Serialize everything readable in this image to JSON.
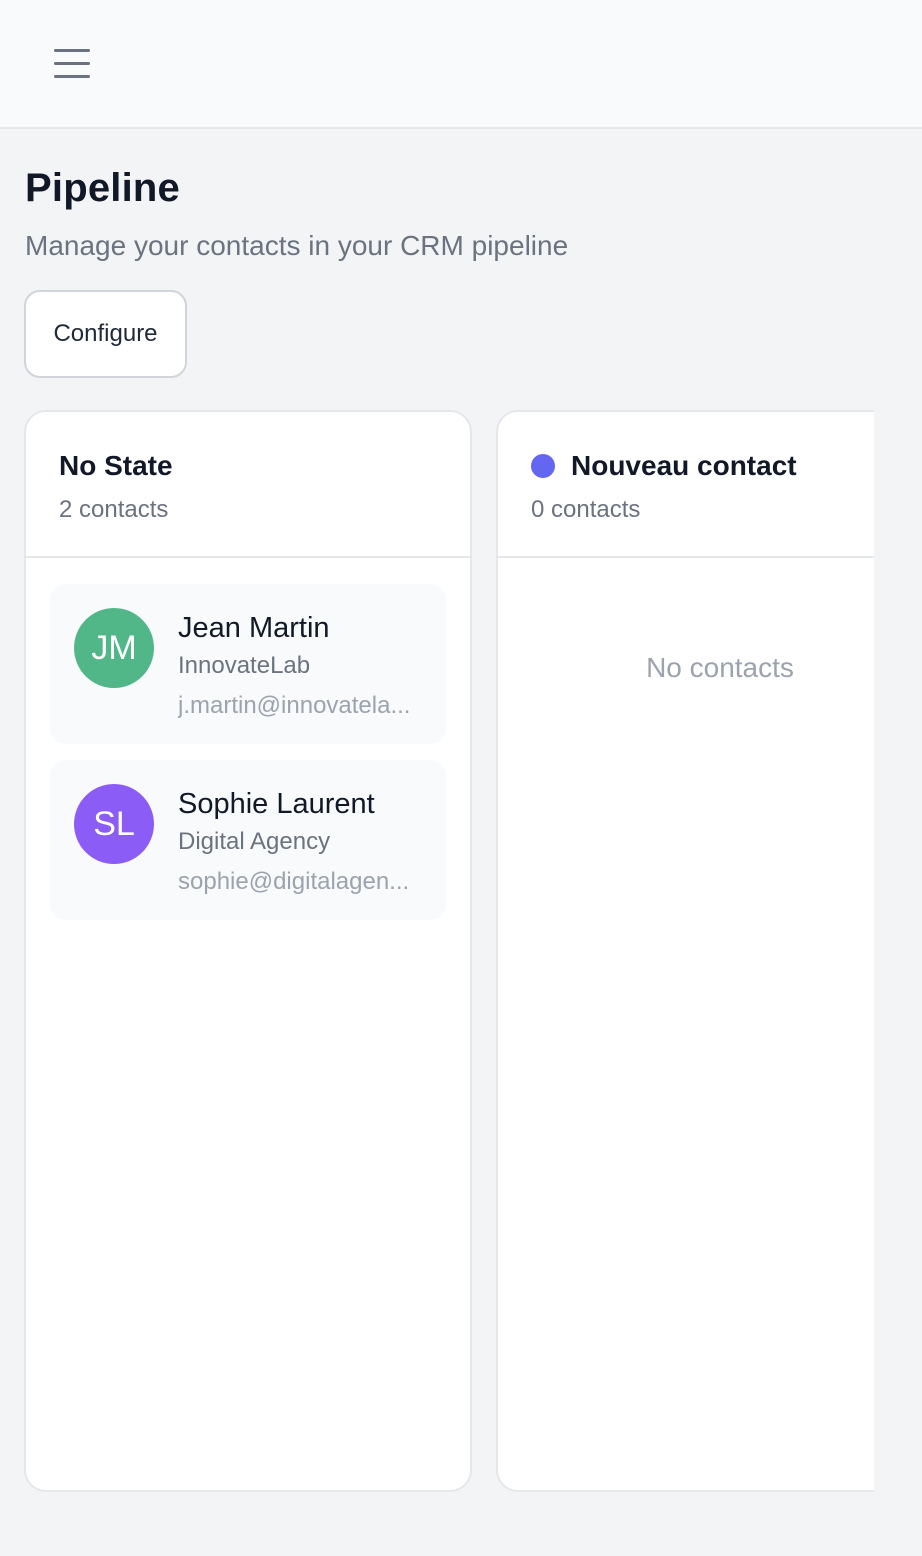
{
  "header": {
    "menu_icon": "hamburger-menu-icon"
  },
  "page": {
    "title": "Pipeline",
    "subtitle": "Manage your contacts in your CRM pipeline",
    "configure_label": "Configure"
  },
  "columns": [
    {
      "title": "No State",
      "count": "2 contacts",
      "contacts": [
        {
          "initials": "JM",
          "name": "Jean Martin",
          "company": "InnovateLab",
          "email": "j.martin@innovatela...",
          "avatar_color": "#52b788"
        },
        {
          "initials": "SL",
          "name": "Sophie Laurent",
          "company": "Digital Agency",
          "email": "sophie@digitalagen...",
          "avatar_color": "#8b5cf6"
        }
      ]
    },
    {
      "title": "Nouveau contact",
      "count": "0 contacts",
      "dot_color": "#6366f1",
      "empty_text": "No contacts"
    }
  ]
}
